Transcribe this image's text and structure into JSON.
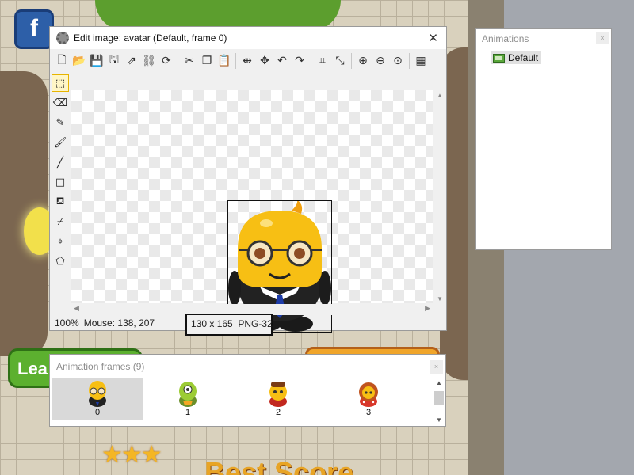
{
  "background": {
    "facebook_letter": "f",
    "lea_button_text": "Lea",
    "best_score_text": "Best Score",
    "stars": "★★★"
  },
  "animations_panel": {
    "title": "Animations",
    "close_label": "×",
    "items": [
      {
        "label": "Default",
        "icon": "film-icon",
        "selected": true
      }
    ]
  },
  "edit_window": {
    "title": "Edit image: avatar (Default, frame 0)",
    "close_label": "✕",
    "toolbar": [
      "new-icon",
      "open-icon",
      "save-icon",
      "save-as-icon",
      "export-icon",
      "link-icon",
      "refresh-icon",
      "cut-icon",
      "copy-icon",
      "paste-icon",
      "flip-horizontal-icon",
      "flip-vertical-icon",
      "rotate-left-icon",
      "rotate-right-icon",
      "crop-icon",
      "resize-icon",
      "zoom-in-icon",
      "zoom-out-icon",
      "zoom-reset-icon",
      "transparency-icon"
    ],
    "tools": [
      "select-rect-icon",
      "eraser-icon",
      "pencil-icon",
      "brush-icon",
      "line-icon",
      "rectangle-icon",
      "fill-bucket-icon",
      "eyedropper-icon",
      "hotspot-icon",
      "polygon-icon"
    ],
    "status": {
      "zoom": "100%",
      "mouse": "Mouse: 138, 207",
      "dimensions": "130 x 165",
      "format": "PNG-32"
    }
  },
  "frames_panel": {
    "title": "Animation frames (9)",
    "close_label": "×",
    "frames": [
      {
        "label": "0",
        "character": "yellow-glasses",
        "selected": true
      },
      {
        "label": "1",
        "character": "green-cyclops",
        "selected": false
      },
      {
        "label": "2",
        "character": "hat-yellow",
        "selected": false
      },
      {
        "label": "3",
        "character": "red-hair-girl",
        "selected": false
      }
    ]
  },
  "colors": {
    "accent_selected_tool": "#fff6c6",
    "frame_selected_bg": "#d9d9d9"
  }
}
